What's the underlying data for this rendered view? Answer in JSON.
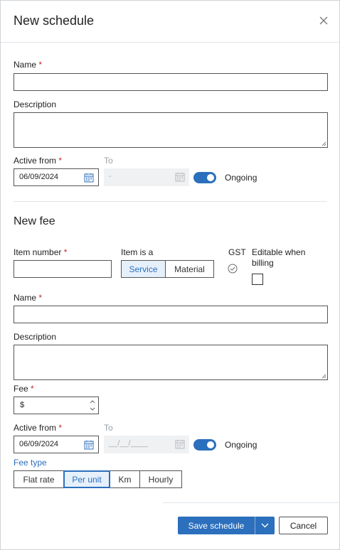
{
  "header": {
    "title": "New schedule"
  },
  "schedule": {
    "name_label": "Name",
    "required_mark": "*",
    "description_label": "Description",
    "active_from_label": "Active from",
    "to_label": "To",
    "active_from_value": "06/09/2024",
    "to_value": "-",
    "ongoing_label": "Ongoing",
    "ongoing_on": true
  },
  "fee_section": {
    "title": "New fee",
    "item_number_label": "Item number",
    "item_is_a_label": "Item is a",
    "item_type_options": [
      "Service",
      "Material"
    ],
    "item_type_selected": "Service",
    "gst_label": "GST",
    "editable_label_line1": "Editable when",
    "editable_label_line2": "billing",
    "editable_checked": false,
    "name_label": "Name",
    "description_label": "Description",
    "fee_label": "Fee",
    "fee_prefix": "$",
    "active_from_label": "Active from",
    "to_label": "To",
    "active_from_value": "06/09/2024",
    "to_value": "__/__/____",
    "ongoing_label": "Ongoing",
    "ongoing_on": true,
    "fee_type_label": "Fee type",
    "fee_type_options": [
      "Flat rate",
      "Per unit",
      "Km",
      "Hourly"
    ],
    "fee_type_selected": "Per unit"
  },
  "footer": {
    "save_label": "Save schedule",
    "cancel_label": "Cancel"
  },
  "colors": {
    "accent": "#2c6fbd",
    "required": "#c62828",
    "border": "#555555",
    "muted": "#9aa0a6"
  }
}
